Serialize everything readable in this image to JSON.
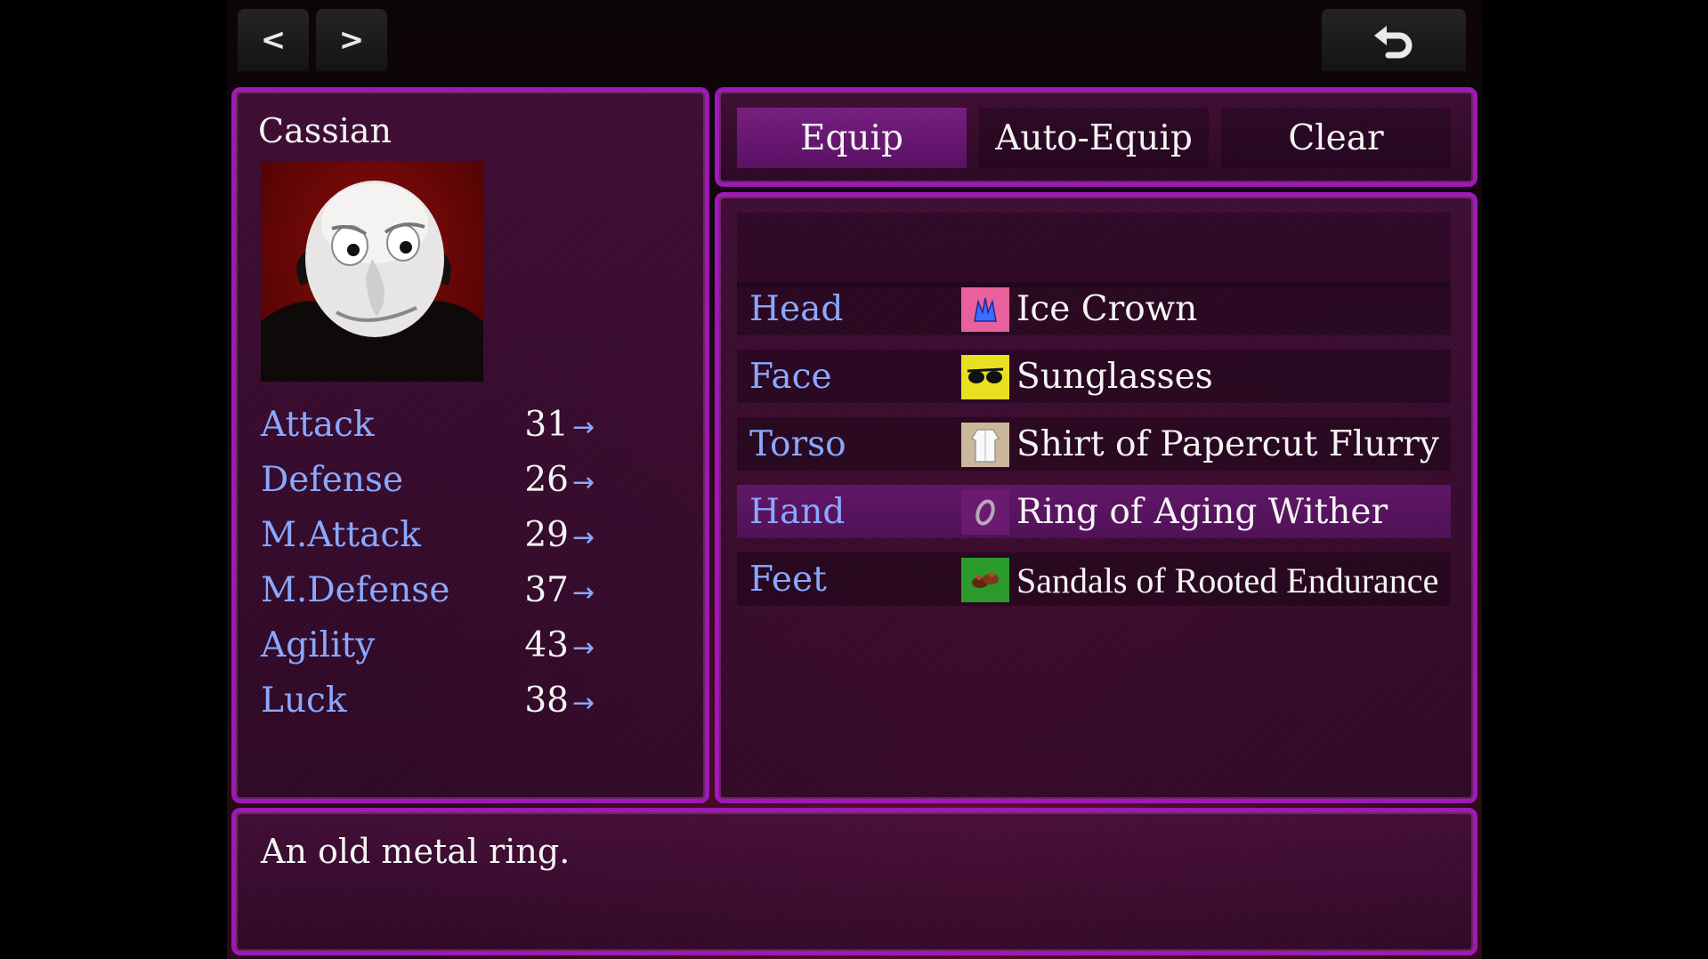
{
  "nav": {
    "prev_label": "<",
    "next_label": ">",
    "back_icon": "undo-arrow-icon"
  },
  "actor": {
    "name": "Cassian",
    "portrait": "pale-gremlin-face-portrait",
    "stats": [
      {
        "label": "Attack",
        "value": "31",
        "arrow": "→"
      },
      {
        "label": "Defense",
        "value": "26",
        "arrow": "→"
      },
      {
        "label": "M.Attack",
        "value": "29",
        "arrow": "→"
      },
      {
        "label": "M.Defense",
        "value": "37",
        "arrow": "→"
      },
      {
        "label": "Agility",
        "value": "43",
        "arrow": "→"
      },
      {
        "label": "Luck",
        "value": "38",
        "arrow": "→"
      }
    ]
  },
  "commands": [
    {
      "label": "Equip",
      "selected": true
    },
    {
      "label": "Auto-Equip",
      "selected": false
    },
    {
      "label": "Clear",
      "selected": false
    }
  ],
  "slots": [
    {
      "slot": "Head",
      "item": "Ice Crown",
      "icon": "ice-crown-icon",
      "icon_bg": "#e8609c",
      "selected": false
    },
    {
      "slot": "Face",
      "item": "Sunglasses",
      "icon": "sunglasses-icon",
      "icon_bg": "#e8e020",
      "selected": false
    },
    {
      "slot": "Torso",
      "item": "Shirt of Papercut Flurry",
      "icon": "shirt-icon",
      "icon_bg": "#cbb79a",
      "selected": false
    },
    {
      "slot": "Hand",
      "item": "Ring of Aging Wither",
      "icon": "ring-icon",
      "icon_bg": "#6a1a70",
      "selected": true
    },
    {
      "slot": "Feet",
      "item": "Sandals of Rooted Endurance",
      "icon": "sandals-icon",
      "icon_bg": "#2a9a2a",
      "selected": false
    }
  ],
  "help_text": "An old metal ring.",
  "colors": {
    "window_border": "#a019b8",
    "label_blue": "#8aa8ff",
    "text": "#f4f4f4"
  }
}
